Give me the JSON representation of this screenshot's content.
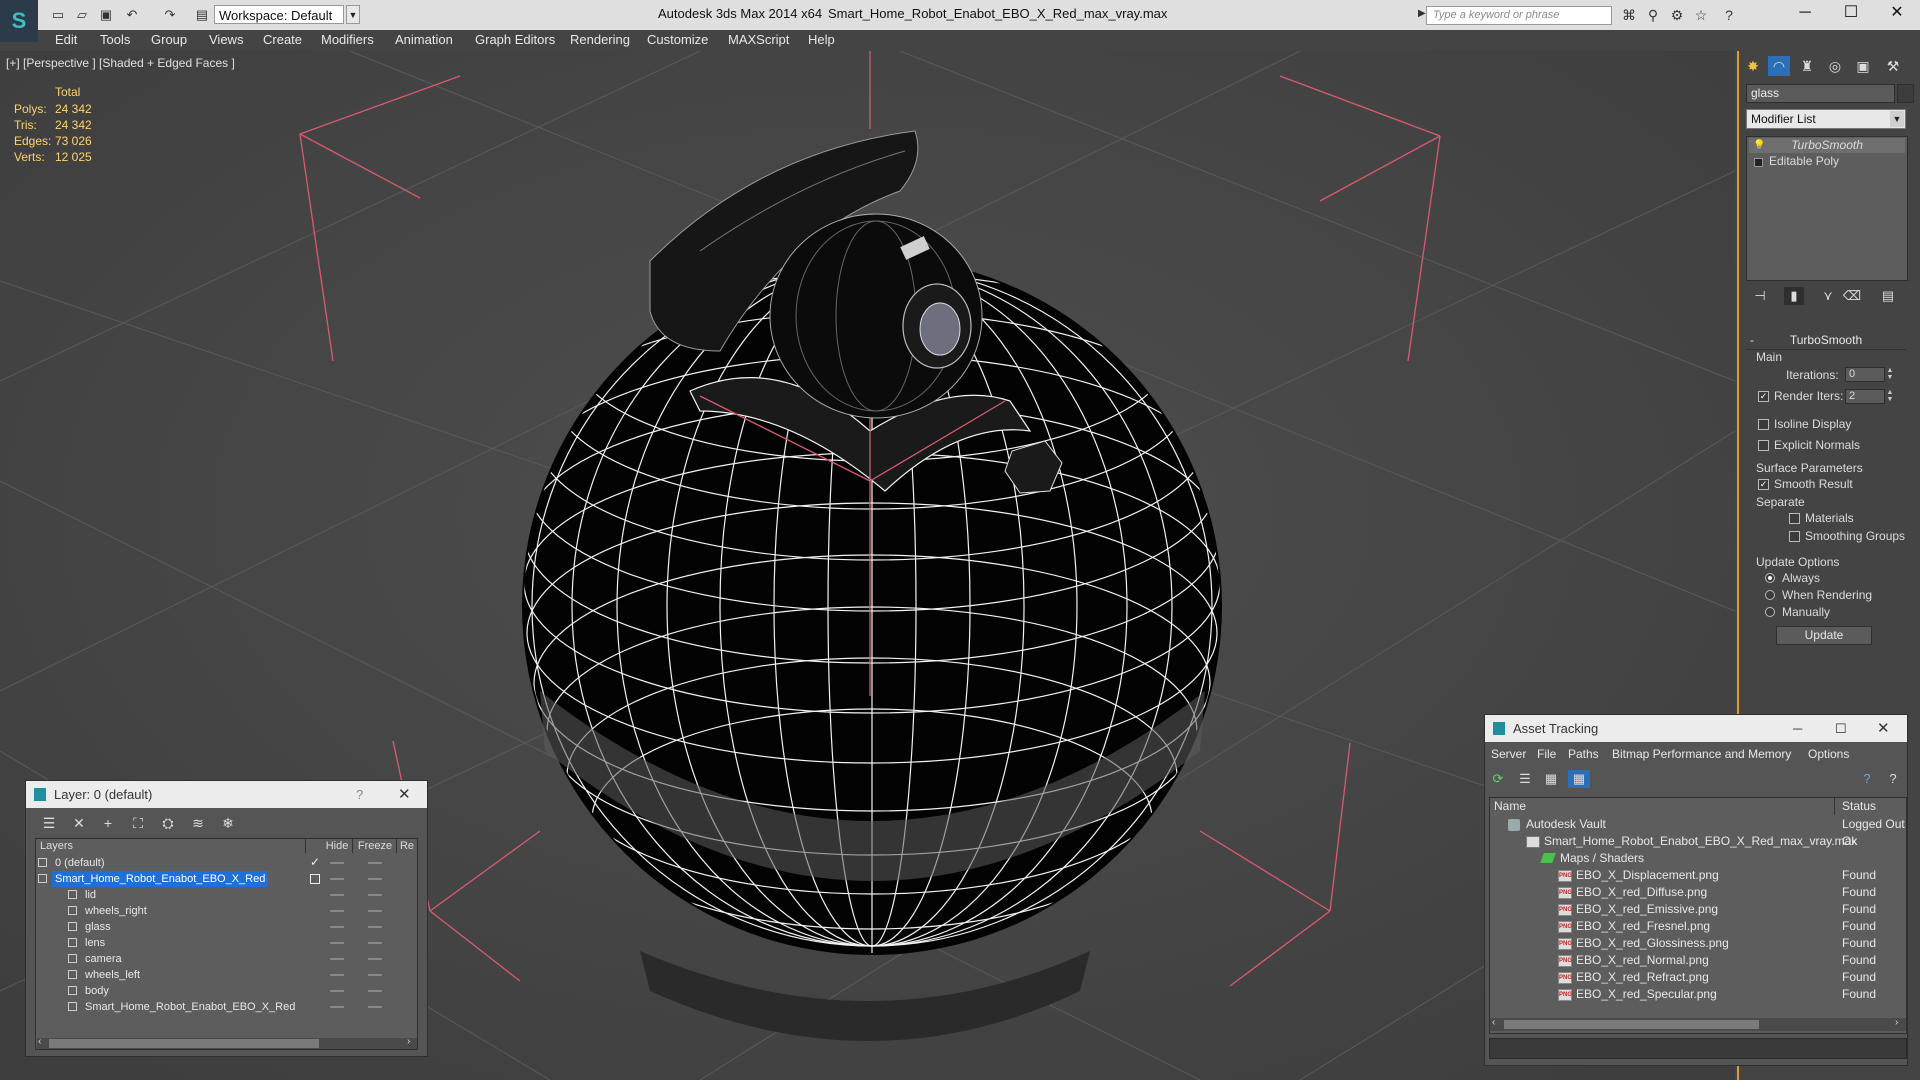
{
  "titlebar": {
    "workspace": "Workspace: Default",
    "app_title": "Autodesk 3ds Max  2014 x64",
    "file_title": "Smart_Home_Robot_Enabot_EBO_X_Red_max_vray.max",
    "search_placeholder": "Type a keyword or phrase"
  },
  "menu": [
    "Edit",
    "Tools",
    "Group",
    "Views",
    "Create",
    "Modifiers",
    "Animation",
    "Graph Editors",
    "Rendering",
    "Customize",
    "MAXScript",
    "Help"
  ],
  "viewport": {
    "label": "[+] [Perspective ] [Shaded + Edged Faces ]",
    "stats_header": "Total",
    "stats": [
      {
        "label": "Polys:",
        "value": "24 342"
      },
      {
        "label": "Tris:",
        "value": "24 342"
      },
      {
        "label": "Edges:",
        "value": "73 026"
      },
      {
        "label": "Verts:",
        "value": "12 025"
      }
    ]
  },
  "command_panel": {
    "object_name": "glass",
    "modifier_list": "Modifier List",
    "stack": [
      "TurboSmooth",
      "Editable Poly"
    ],
    "rollout_title": "TurboSmooth",
    "main_label": "Main",
    "iterations_label": "Iterations:",
    "iterations_value": "0",
    "render_iters_label": "Render Iters:",
    "render_iters_value": "2",
    "isoline_label": "Isoline Display",
    "explicit_normals_label": "Explicit Normals",
    "surface_params_label": "Surface Parameters",
    "smooth_result_label": "Smooth Result",
    "separate_label": "Separate",
    "materials_label": "Materials",
    "smoothing_groups_label": "Smoothing Groups",
    "update_options_label": "Update Options",
    "always_label": "Always",
    "when_rendering_label": "When Rendering",
    "manually_label": "Manually",
    "update_button": "Update"
  },
  "layer_window": {
    "title": "Layer: 0 (default)",
    "help": "?",
    "col_layers": "Layers",
    "col_hide": "Hide",
    "col_freeze": "Freeze",
    "col_render": "Re",
    "rows": [
      {
        "name": "0 (default)"
      },
      {
        "name": "Smart_Home_Robot_Enabot_EBO_X_Red"
      },
      {
        "name": "lid"
      },
      {
        "name": "wheels_right"
      },
      {
        "name": "glass"
      },
      {
        "name": "lens"
      },
      {
        "name": "camera"
      },
      {
        "name": "wheels_left"
      },
      {
        "name": "body"
      },
      {
        "name": "Smart_Home_Robot_Enabot_EBO_X_Red"
      }
    ]
  },
  "asset_window": {
    "title": "Asset Tracking",
    "menu": [
      "Server",
      "File",
      "Paths",
      "Bitmap Performance and Memory",
      "Options"
    ],
    "col_name": "Name",
    "col_status": "Status",
    "rows": [
      {
        "name": "Autodesk Vault",
        "status": "Logged Out"
      },
      {
        "name": "Smart_Home_Robot_Enabot_EBO_X_Red_max_vray.max",
        "status": "Ok"
      },
      {
        "name": "Maps / Shaders",
        "status": ""
      },
      {
        "name": "EBO_X_Displacement.png",
        "status": "Found"
      },
      {
        "name": "EBO_X_red_Diffuse.png",
        "status": "Found"
      },
      {
        "name": "EBO_X_red_Emissive.png",
        "status": "Found"
      },
      {
        "name": "EBO_X_red_Fresnel.png",
        "status": "Found"
      },
      {
        "name": "EBO_X_red_Glossiness.png",
        "status": "Found"
      },
      {
        "name": "EBO_X_red_Normal.png",
        "status": "Found"
      },
      {
        "name": "EBO_X_red_Refract.png",
        "status": "Found"
      },
      {
        "name": "EBO_X_red_Specular.png",
        "status": "Found"
      }
    ]
  },
  "colors": {
    "accent": "#e79a2a",
    "selection": "#1e6fd9",
    "stats_text": "#ffd36a",
    "grid_line": "#5a5a5a",
    "bbox": "#d85a70"
  }
}
